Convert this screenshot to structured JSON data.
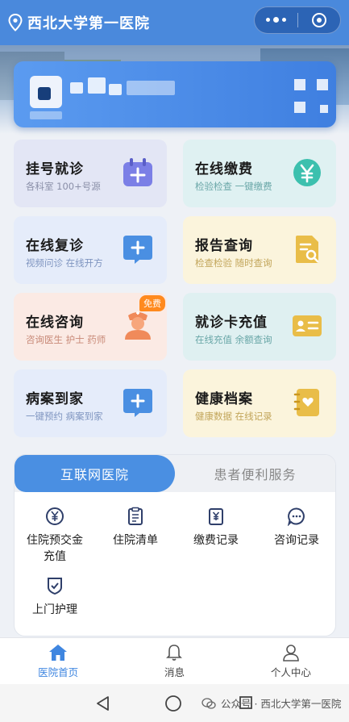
{
  "header": {
    "title": "西北大学第一医院"
  },
  "services": [
    {
      "title": "挂号就诊",
      "subtitle": "各科室 100+号源"
    },
    {
      "title": "在线缴费",
      "subtitle": "检验检查 一键缴费"
    },
    {
      "title": "在线复诊",
      "subtitle": "视频问诊 在线开方"
    },
    {
      "title": "报告查询",
      "subtitle": "检查检验 随时查询"
    },
    {
      "title": "在线咨询",
      "subtitle": "咨询医生 护士 药师",
      "badge": "免费"
    },
    {
      "title": "就诊卡充值",
      "subtitle": "在线充值 余额查询"
    },
    {
      "title": "病案到家",
      "subtitle": "一键预约 病案到家"
    },
    {
      "title": "健康档案",
      "subtitle": "健康数据 在线记录"
    }
  ],
  "tabs": [
    {
      "label": "互联网医院"
    },
    {
      "label": "患者便利服务"
    }
  ],
  "panel_items": [
    {
      "label": "住院预交金充值",
      "line1": "住院预交金",
      "line2": "充值"
    },
    {
      "label": "住院清单"
    },
    {
      "label": "缴费记录"
    },
    {
      "label": "咨询记录"
    },
    {
      "label": "上门护理"
    }
  ],
  "bottom_nav": [
    {
      "label": "医院首页"
    },
    {
      "label": "消息"
    },
    {
      "label": "个人中心"
    }
  ],
  "watermark": {
    "text": "公众号 · 西北大学第一医院"
  },
  "colors": {
    "brand": "#4a89dc",
    "active_tab": "#4a8fe2",
    "nav_active": "#3f86e0"
  }
}
